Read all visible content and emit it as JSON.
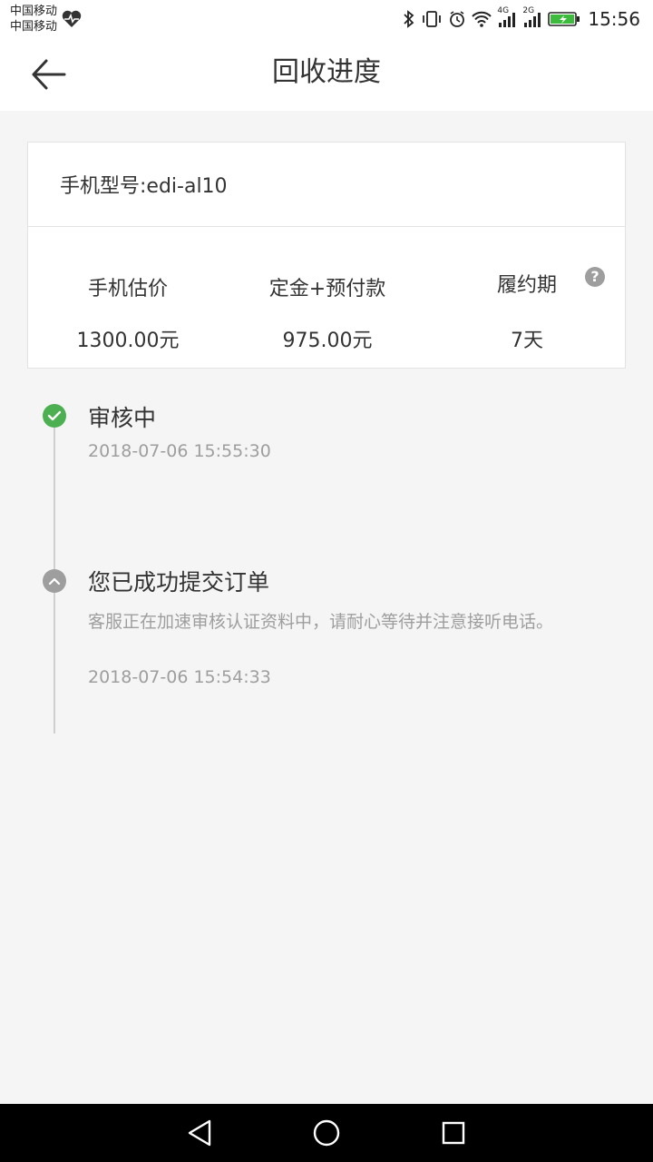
{
  "status_bar": {
    "carrier_1": "中国移动",
    "carrier_2": "中国移动",
    "network_1": "4G",
    "network_2": "2G",
    "time": "15:56",
    "icons": [
      "heart-rate-icon",
      "bluetooth-icon",
      "vibrate-icon",
      "alarm-icon",
      "wifi-icon",
      "signal-icon",
      "signal-icon",
      "battery-icon"
    ],
    "battery_color": "#3dbb3d"
  },
  "app_bar": {
    "back_icon": "back-arrow-icon",
    "title": "回收进度"
  },
  "card": {
    "model": "手机型号:edi-al10",
    "stats": [
      {
        "label": "手机估价",
        "value": "1300.00元"
      },
      {
        "label": "定金+预付款",
        "value": "975.00元"
      },
      {
        "label": "履约期",
        "value": "7天"
      }
    ],
    "help_icon_glyph": "?"
  },
  "timeline": [
    {
      "status": "done",
      "color": "#4caf50",
      "title": "审核中",
      "desc": "",
      "time": "2018-07-06 15:55:30"
    },
    {
      "status": "pending",
      "color": "#9e9e9e",
      "title": "您已成功提交订单",
      "desc": "客服正在加速审核认证资料中，请耐心等待并注意接听电话。",
      "time": "2018-07-06 15:54:33"
    }
  ],
  "nav_bar": {
    "icons": [
      "back-triangle-icon",
      "home-circle-icon",
      "recents-square-icon"
    ]
  }
}
